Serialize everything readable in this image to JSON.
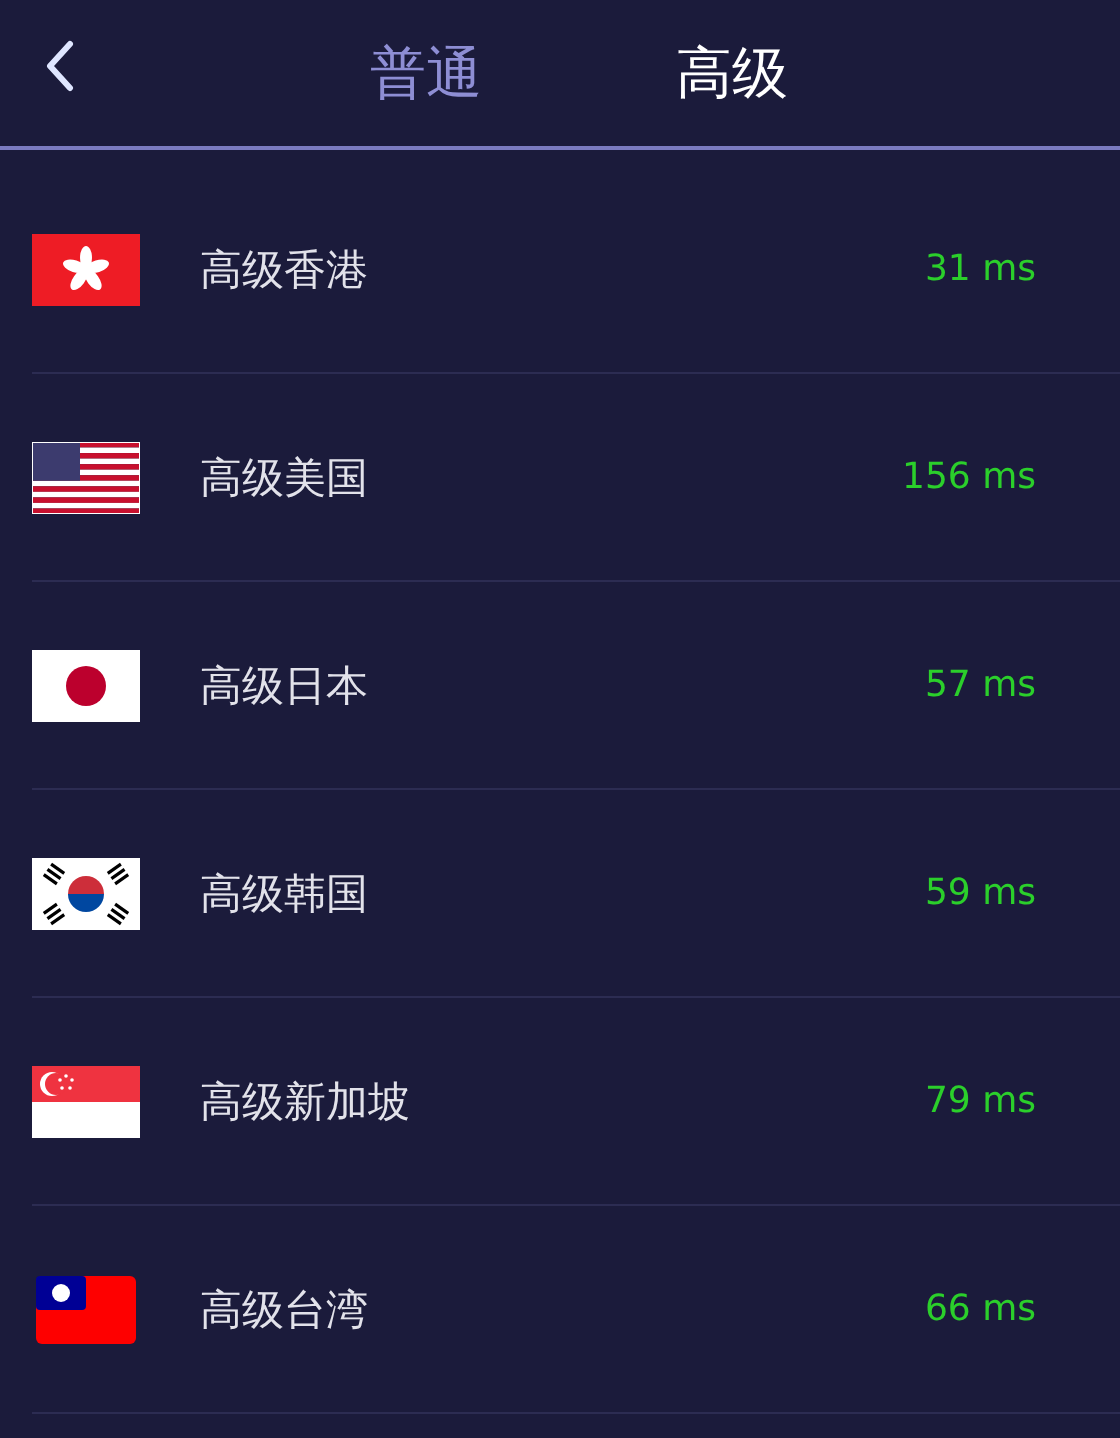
{
  "header": {
    "tabs": [
      {
        "label": "普通",
        "selected": false
      },
      {
        "label": "高级",
        "selected": true
      }
    ]
  },
  "servers": [
    {
      "kind": "hk",
      "name": "高级香港",
      "latency": "31 ms"
    },
    {
      "kind": "us",
      "name": "高级美国",
      "latency": "156 ms"
    },
    {
      "kind": "jp",
      "name": "高级日本",
      "latency": "57 ms"
    },
    {
      "kind": "kr",
      "name": "高级韩国",
      "latency": "59 ms"
    },
    {
      "kind": "sg",
      "name": "高级新加坡",
      "latency": "79 ms"
    },
    {
      "kind": "tw",
      "name": "高级台湾",
      "latency": "66 ms"
    }
  ]
}
